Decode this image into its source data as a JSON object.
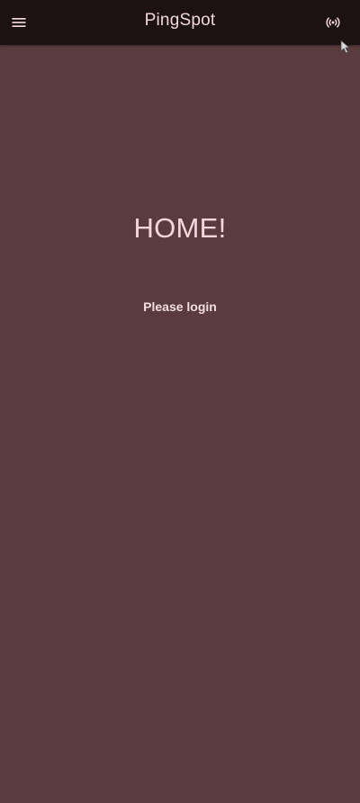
{
  "appbar": {
    "title": "PingSpot",
    "menu_icon": "hamburger-menu-icon",
    "action_icon": "broadcast-ping-icon"
  },
  "main": {
    "heading": "HOME!",
    "login_prompt": "Please login"
  },
  "colors": {
    "appbar_background": "#1c1113",
    "page_background": "#5b3c3e",
    "text_primary": "#f4d6dc"
  }
}
